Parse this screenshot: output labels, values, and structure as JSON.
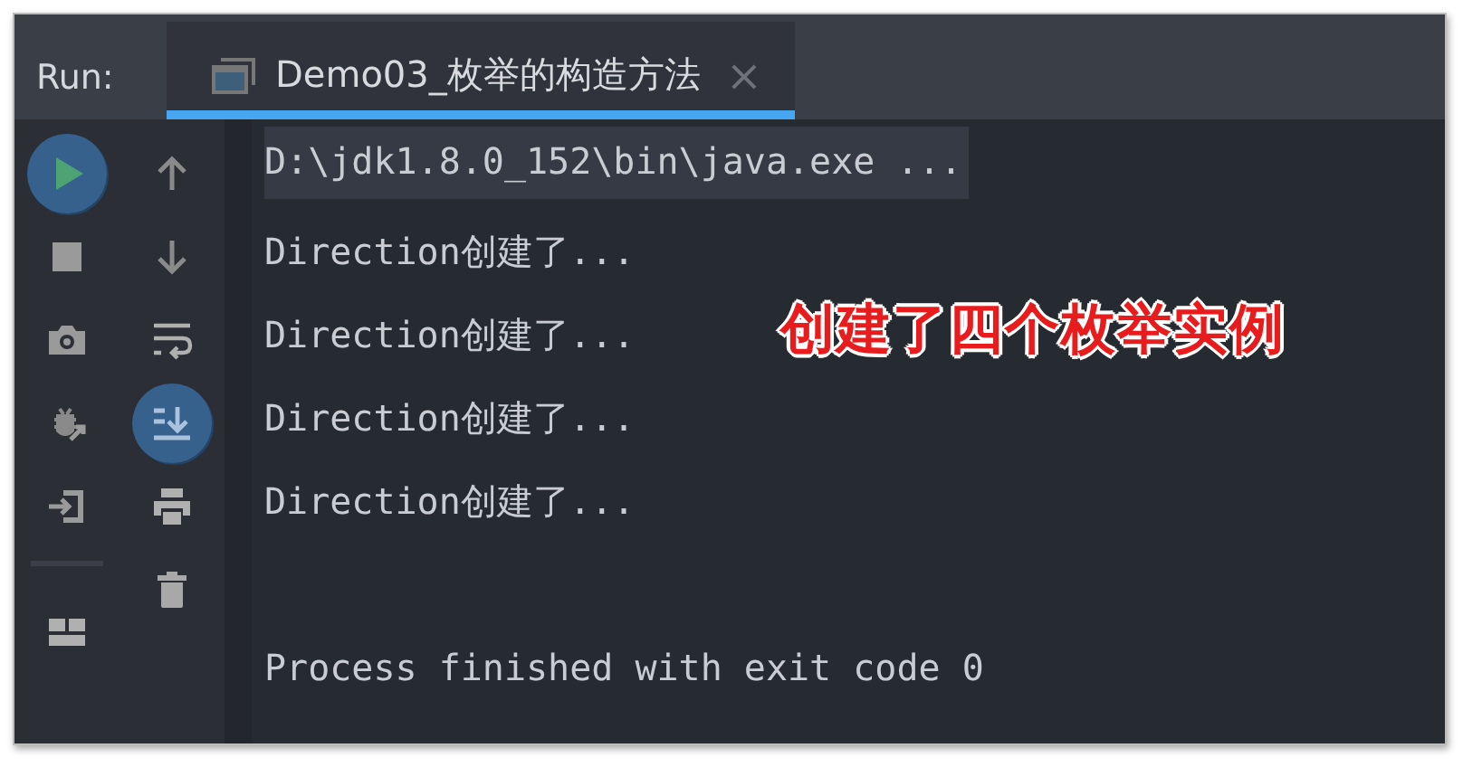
{
  "run_label": "Run:",
  "tab": {
    "title": "Demo03_枚举的构造方法",
    "close": "×",
    "selected": true
  },
  "toolbar_left": [
    {
      "kind": "play",
      "on": true
    },
    {
      "kind": "stop",
      "on": false
    },
    {
      "kind": "camera",
      "on": false
    },
    {
      "kind": "bug",
      "on": false
    },
    {
      "kind": "exit",
      "on": false
    },
    {
      "kind": "divider"
    },
    {
      "kind": "layout",
      "on": false
    }
  ],
  "toolbar_right": [
    {
      "kind": "up",
      "on": false
    },
    {
      "kind": "down",
      "on": false
    },
    {
      "kind": "wrap",
      "on": false
    },
    {
      "kind": "scroll",
      "on": true
    },
    {
      "kind": "print",
      "on": false
    },
    {
      "kind": "trash",
      "on": false
    }
  ],
  "console_lines": [
    {
      "kind": "command",
      "text": "D:\\jdk1.8.0_152\\bin\\java.exe ..."
    },
    {
      "kind": "output",
      "text": "Direction创建了..."
    },
    {
      "kind": "output",
      "text": "Direction创建了..."
    },
    {
      "kind": "output",
      "text": "Direction创建了..."
    },
    {
      "kind": "output",
      "text": "Direction创建了..."
    },
    {
      "kind": "status",
      "text": "Process finished with exit code 0"
    }
  ],
  "annotation": "创建了四个枚举实例"
}
